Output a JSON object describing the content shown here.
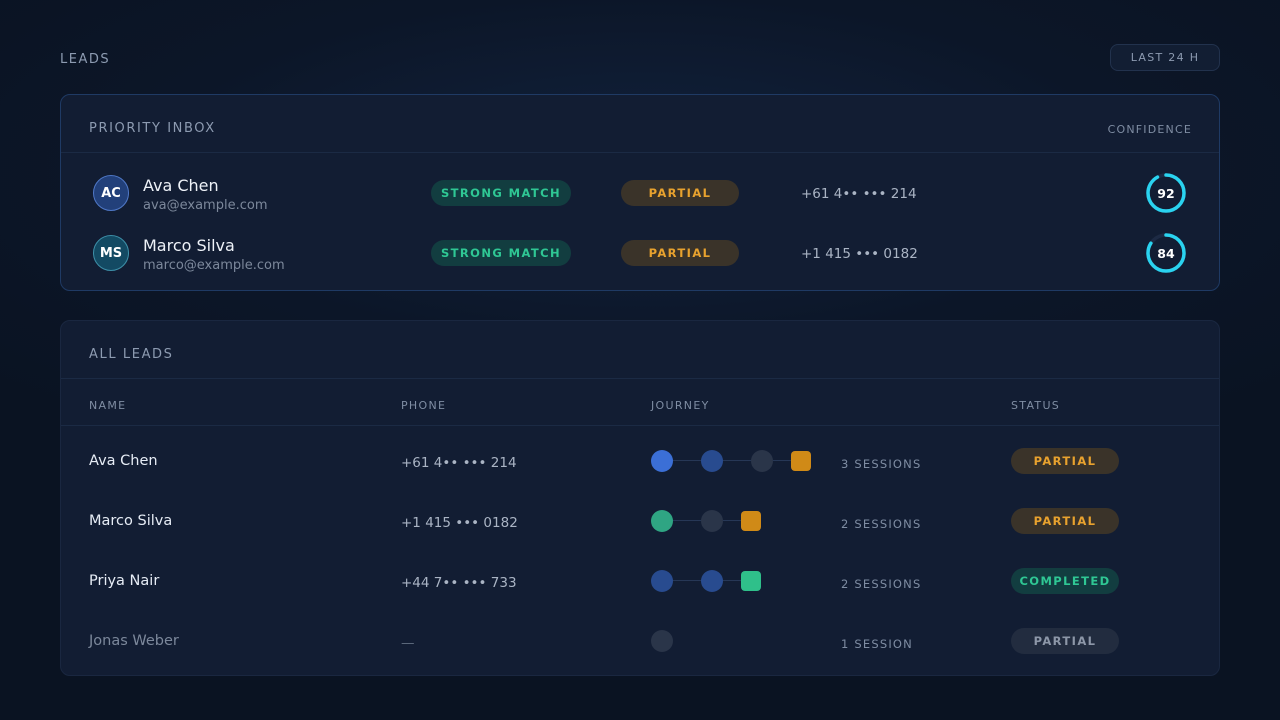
{
  "header": {
    "title": "LEADS",
    "range_label": "LAST 24 H"
  },
  "colors": {
    "match": "#2fc794",
    "partial": "#e8a22e",
    "ring": "#2ad3f0",
    "dot_blue": "#3b6fd6",
    "dot_navy": "#284b8f",
    "dot_gray": "#2a3549",
    "dot_teal": "#2fa583",
    "sq_amber": "#d08a17",
    "sq_green": "#2fc08a"
  },
  "priority": {
    "title": "PRIORITY INBOX",
    "aside": "CONFIDENCE",
    "rows": [
      {
        "initials": "AC",
        "name": "Ava Chen",
        "email": "ava@example.com",
        "match": "STRONG MATCH",
        "status": "PARTIAL",
        "phone": "+61 4•• ••• 214",
        "confidence": 92
      },
      {
        "initials": "MS",
        "name": "Marco Silva",
        "email": "marco@example.com",
        "match": "STRONG MATCH",
        "status": "PARTIAL",
        "phone": "+1 415 ••• 0182",
        "confidence": 84
      }
    ]
  },
  "all_leads": {
    "title": "ALL LEADS",
    "columns": [
      "NAME",
      "PHONE",
      "JOURNEY",
      "STATUS"
    ],
    "rows": [
      {
        "name": "Ava Chen",
        "phone": "+61 4•• ••• 214",
        "journey": [
          "dot_blue",
          "dot_navy",
          "dot_gray",
          "sq_amber"
        ],
        "sessions": "3 SESSIONS",
        "status": "PARTIAL",
        "status_style": "partial"
      },
      {
        "name": "Marco Silva",
        "phone": "+1 415 ••• 0182",
        "journey": [
          "dot_teal",
          "dot_gray",
          "sq_amber"
        ],
        "sessions": "2 SESSIONS",
        "status": "PARTIAL",
        "status_style": "partial"
      },
      {
        "name": "Priya Nair",
        "phone": "+44 7•• ••• 733",
        "journey": [
          "dot_navy",
          "dot_navy",
          "sq_green"
        ],
        "sessions": "2 SESSIONS",
        "status": "COMPLETED",
        "status_style": "completed"
      },
      {
        "name": "Jonas Weber",
        "phone": "—",
        "journey": [
          "dot_gray"
        ],
        "sessions": "1 SESSION",
        "status": "PARTIAL",
        "status_style": "muted"
      }
    ]
  }
}
